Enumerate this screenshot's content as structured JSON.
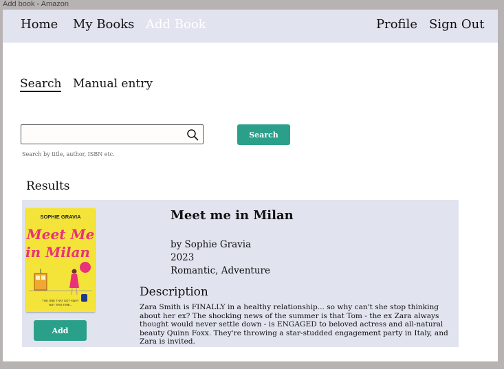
{
  "window": {
    "title": "Add book - Amazon"
  },
  "nav": {
    "home": "Home",
    "my_books": "My Books",
    "add_book": "Add Book",
    "profile": "Profile",
    "sign_out": "Sign Out"
  },
  "tabs": {
    "search": "Search",
    "manual": "Manual entry"
  },
  "search": {
    "value": "",
    "placeholder": "",
    "hint": "Search by title, author, ISBN etc.",
    "button": "Search"
  },
  "results": {
    "heading": "Results",
    "items": [
      {
        "title": "Meet me in Milan",
        "author": "by Sophie Gravia",
        "year": "2023",
        "genres": "Romantic, Adventure",
        "description_heading": "Description",
        "description": "Zara Smith is FINALLY in a healthy relationship... so why can't she stop thinking about her ex? The shocking news of the summer is that Tom - the ex Zara always thought would never settle down - is ENGAGED to beloved actress and all-natural beauty Quinn Foxx. They're throwing a star-studded engagement party in Italy, and Zara is invited.",
        "add_label": "Add",
        "cover": {
          "author": "SOPHIE GRAVIA",
          "title_line1": "Meet Me",
          "title_line2": "in Milan",
          "tagline_line1": "THE ONE THAT GOT AWAY",
          "tagline_line2": "NOT THIS TIME...",
          "bg_color": "#f4e43a",
          "title_color": "#e8327a"
        }
      }
    ]
  },
  "colors": {
    "nav_bg": "#e1e4ef",
    "accent": "#2aa08b",
    "card_bg": "#e1e4ef"
  }
}
